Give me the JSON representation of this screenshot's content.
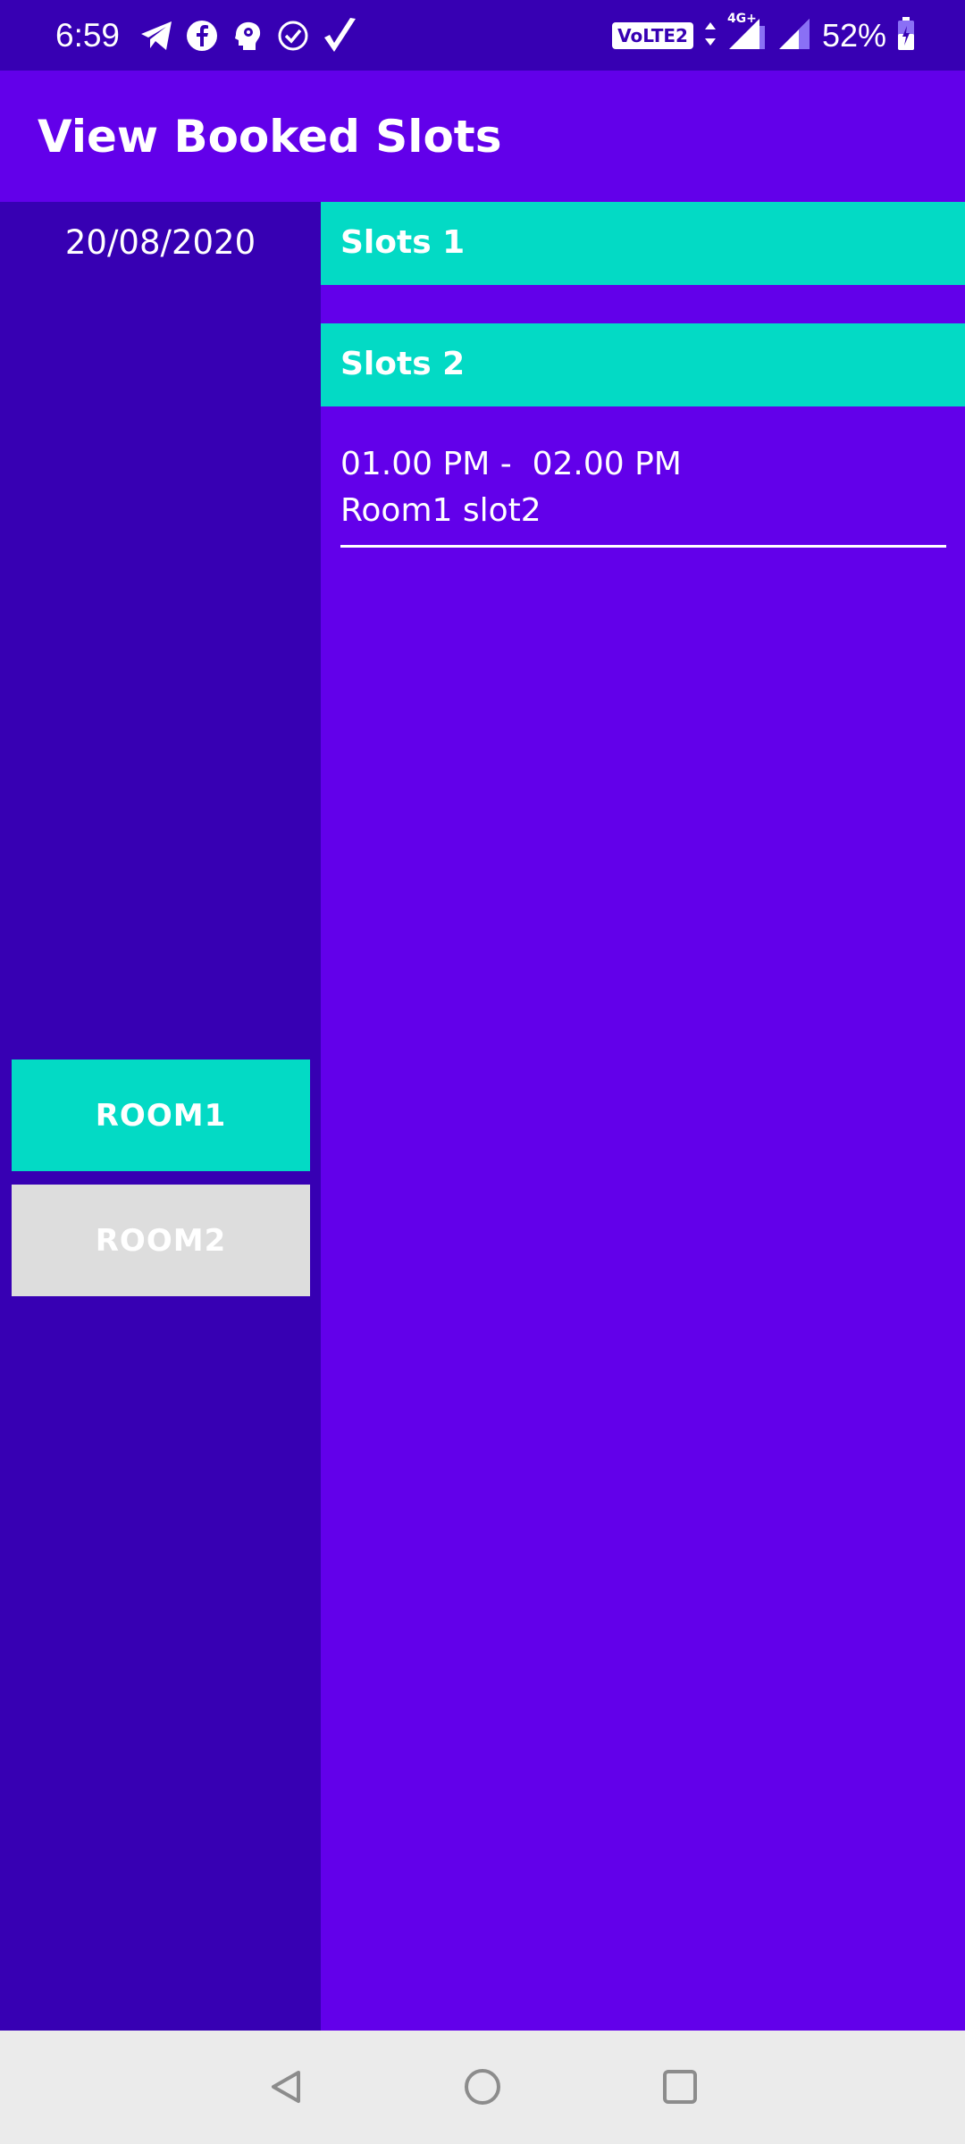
{
  "status_bar": {
    "time": "6:59",
    "volte_label": "VoLTE2",
    "network_label": "4G+",
    "battery": "52%",
    "icons": [
      "telegram-icon",
      "facebook-icon",
      "brain-icon",
      "check-circle-icon",
      "checkmark-icon",
      "signal-icon",
      "battery-icon"
    ]
  },
  "app_bar": {
    "title": "View Booked Slots"
  },
  "left_panel": {
    "date": "20/08/2020",
    "rooms": [
      {
        "label": "ROOM1",
        "color": "#03DAC5",
        "selected": true
      },
      {
        "label": "ROOM2",
        "color": "#DDDDDD",
        "selected": false
      }
    ]
  },
  "right_panel": {
    "slot_groups": [
      {
        "label": "Slots 1"
      },
      {
        "label": "Slots 2"
      }
    ],
    "bookings": [
      {
        "time": "01.00 PM -  02.00 PM",
        "name": "Room1 slot2"
      }
    ]
  },
  "colors": {
    "primary": "#6200EA",
    "primary_dark": "#3700B3",
    "accent": "#03DAC5",
    "disabled": "#DDDDDD"
  }
}
